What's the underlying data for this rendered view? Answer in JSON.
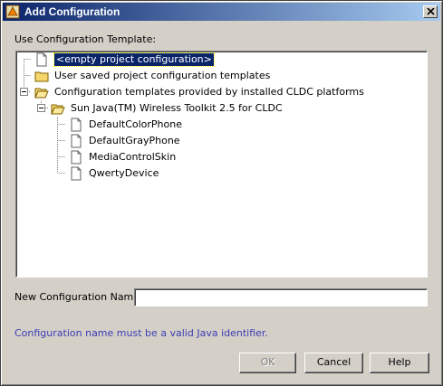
{
  "window": {
    "title": "Add Configuration",
    "close_glyph": "close-icon"
  },
  "template_label": "Use Configuration Template:",
  "tree": {
    "nodes": [
      {
        "label": "<empty project configuration>",
        "icon": "document-icon",
        "selected": true
      },
      {
        "label": "User saved project configuration templates",
        "icon": "folder-icon"
      },
      {
        "label": "Configuration templates provided by installed CLDC platforms",
        "icon": "folder-open-icon",
        "expanded": true
      },
      {
        "label": "Sun Java(TM) Wireless Toolkit 2.5 for CLDC",
        "icon": "folder-open-icon",
        "expanded": true
      },
      {
        "label": "DefaultColorPhone",
        "icon": "document-icon"
      },
      {
        "label": "DefaultGrayPhone",
        "icon": "document-icon"
      },
      {
        "label": "MediaControlSkin",
        "icon": "document-icon"
      },
      {
        "label": "QwertyDevice",
        "icon": "document-icon"
      }
    ]
  },
  "name_field": {
    "label": "New Configuration Name:",
    "value": ""
  },
  "hint": "Configuration name must be a valid Java identifier.",
  "buttons": {
    "ok": "OK",
    "cancel": "Cancel",
    "help": "Help"
  },
  "colors": {
    "title_start": "#0a246a",
    "title_end": "#a6caf0",
    "selection": "#0a246a",
    "hint": "#3c3cb4",
    "folder": "#f5d66b"
  }
}
